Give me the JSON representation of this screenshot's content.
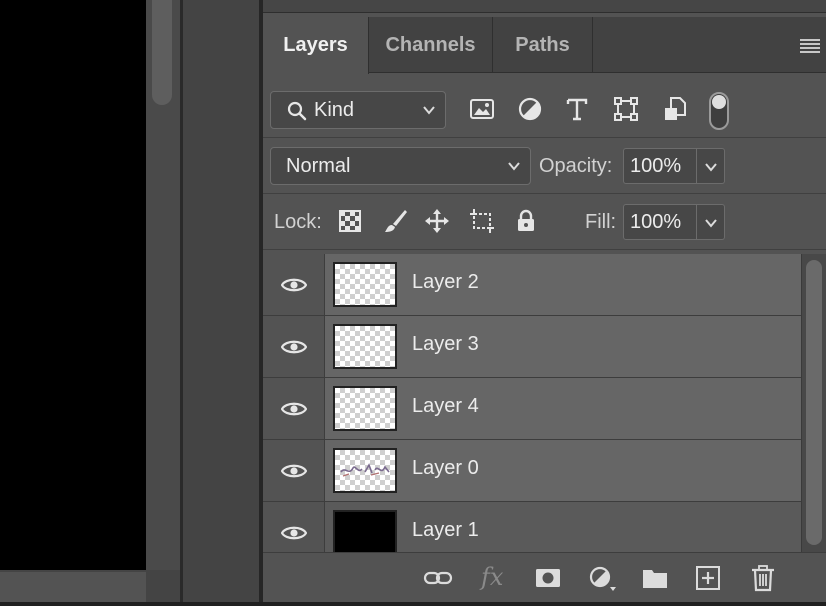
{
  "tabs": [
    {
      "label": "Layers",
      "active": true
    },
    {
      "label": "Channels",
      "active": false
    },
    {
      "label": "Paths",
      "active": false
    }
  ],
  "filter": {
    "kind_label": "Kind",
    "icons": [
      "image-filter-icon",
      "adjustment-filter-icon",
      "type-filter-icon",
      "shape-filter-icon",
      "smart-object-filter-icon"
    ]
  },
  "blend": {
    "mode": "Normal",
    "opacity_label": "Opacity:",
    "opacity_value": "100%"
  },
  "lock": {
    "label": "Lock:",
    "fill_label": "Fill:",
    "fill_value": "100%"
  },
  "layers": [
    {
      "name": "Layer 2",
      "thumb": "transparent",
      "visible": true
    },
    {
      "name": "Layer 3",
      "thumb": "transparent",
      "visible": true
    },
    {
      "name": "Layer 4",
      "thumb": "transparent",
      "visible": true
    },
    {
      "name": "Layer 0",
      "thumb": "content",
      "visible": true
    },
    {
      "name": "Layer 1",
      "thumb": "black",
      "visible": true
    }
  ],
  "bottom_bar": {
    "fx_label": "fx"
  }
}
